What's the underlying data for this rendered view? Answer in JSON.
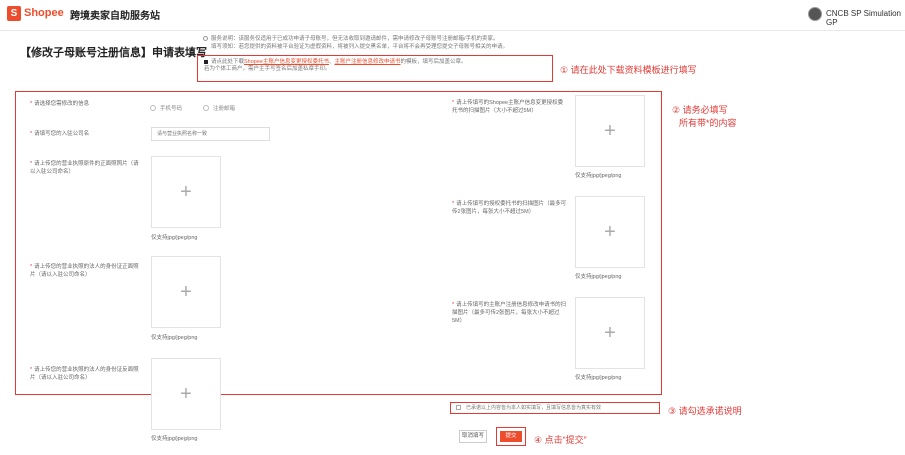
{
  "header": {
    "logo_glyph": "S",
    "logo_text": "Shopee",
    "site_title": "跨境卖家自助服务站",
    "user_name": "CNCB SP Simulation GP"
  },
  "page_title": "【修改子母账号注册信息】申请表填写",
  "notices": [
    "服务说明：该服务仅适用于已成功申请子母账号，但无法收取到邀请邮件，需申请修改子母账号注册邮箱/手机的卖家。",
    "填写须知：若您提供的资料被平台验证为虚假资料，将被列入提交黑名单，平台将不会再受理您提交子母账号相关的申请。"
  ],
  "template_notice": {
    "prefix": "请点此处下载",
    "link1": "Shopee主账户信息变更授权委托书",
    "sep": "、",
    "link2": "主账户注册信息修改申请书",
    "suffix": "的模板，填写后加盖公章。",
    "line2": "若为个体工商户，需户主手写签名后加盖私章手印。"
  },
  "annotations": {
    "a1": "① 请在此处下载资料模板进行填写",
    "a2_line1": "② 请务必填写",
    "a2_line2": "所有带*的内容",
    "a3": "③ 请勾选承诺说明",
    "a4": "④ 点击“提交”"
  },
  "form": {
    "change_label": "请选择您需修改的信息",
    "change_options": [
      "手机号码",
      "注册邮箱"
    ],
    "company_label": "请填写您的入驻公司名",
    "company_placeholder": "请与营业执照名称一致",
    "license_label": "请上传您的营业执照原件的正面照照片（请以入驻公司命名）",
    "id_front_label": "请上传您的营业执照的法人的身份证正面照片（请以入驻公司命名）",
    "id_back_label": "请上传您的营业执照的法人的身份证反面照片（请以入驻公司命名）",
    "email_label": "请上传填写的Shopee主账户信息变更授权委托书的扫描图片（大小不超过5M）",
    "auth_label": "请上传填写的授权委托书的扫描图片（最多可传2张图片，每张大小不超过5M）",
    "modify_label": "请上传填写的主账户注册信息修改申请书的扫描图片（最多可传2张图片，每张大小不超过5M）",
    "upload_plus": "+",
    "upload_hint": "仅支持jpg/jpeg/png",
    "required_mark": "*"
  },
  "pledge_text": "已承诺以上内容皆为本人如实填写，且填写信息皆为真实有效",
  "buttons": {
    "cancel": "取消填写",
    "submit": "提交"
  },
  "colors": {
    "brand": "#ee4d2d",
    "annotation_red": "#e53935"
  }
}
